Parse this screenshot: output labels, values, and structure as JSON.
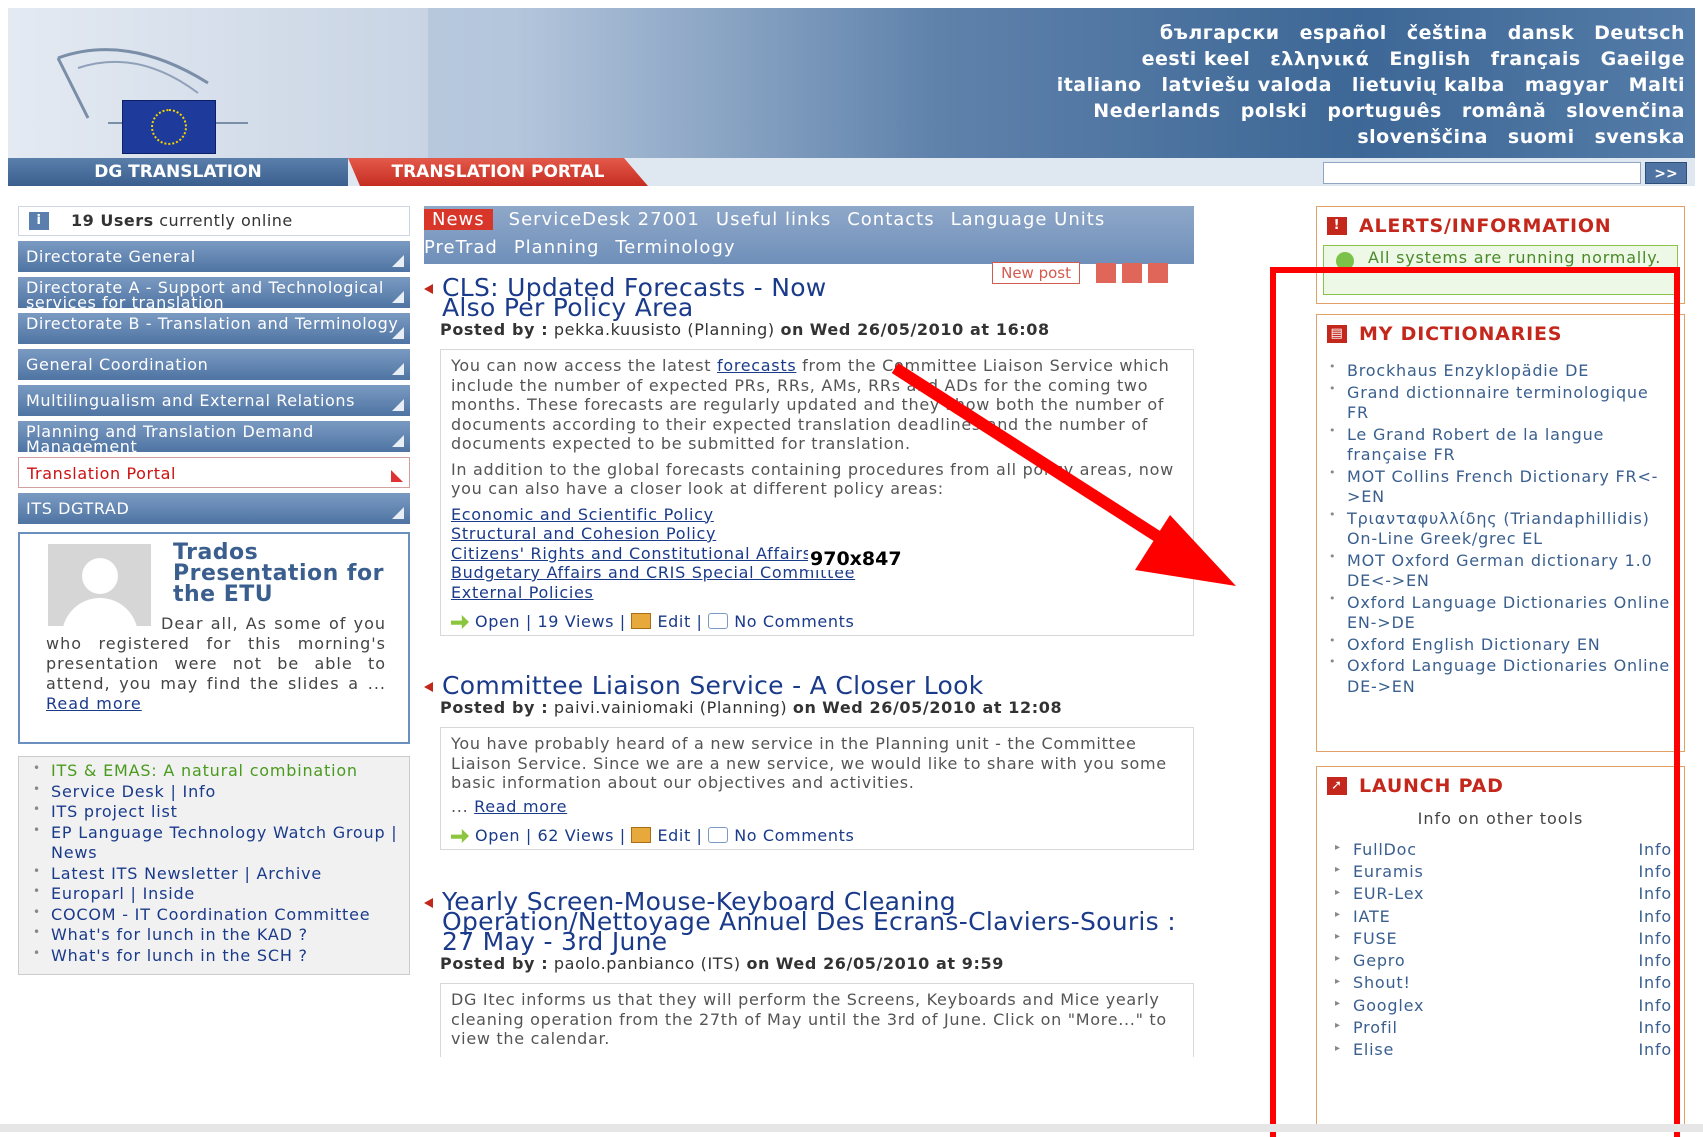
{
  "header": {
    "languages": [
      "български",
      "español",
      "čeština",
      "dansk",
      "Deutsch",
      "eesti keel",
      "ελληνικά",
      "English",
      "français",
      "Gaeilge",
      "italiano",
      "latviešu valoda",
      "lietuvių kalba",
      "magyar",
      "Malti",
      "Nederlands",
      "polski",
      "português",
      "română",
      "slovenčina",
      "slovenščina",
      "suomi",
      "svenska"
    ],
    "tab_dg": "DG TRANSLATION",
    "tab_portal": "TRANSLATION PORTAL",
    "search_button": ">>"
  },
  "left": {
    "users_count": "19 Users",
    "users_suffix": "currently online",
    "menu": [
      {
        "label": "Directorate General"
      },
      {
        "label": "Directorate A - Support and Technological services for translation"
      },
      {
        "label": "Directorate B - Translation and Terminology"
      },
      {
        "label": "General Coordination"
      },
      {
        "label": "Multilingualism and External Relations"
      },
      {
        "label": "Planning and Translation Demand Management"
      },
      {
        "label": "Translation Portal"
      },
      {
        "label": "ITS DGTRAD"
      }
    ],
    "trados": {
      "title": "Trados Presentation for the ETU",
      "text": "Dear all, As some of you who registered for this morning's presentation were not be able to attend, you may find the slides a ...",
      "read_more": "Read more"
    },
    "links": [
      "ITS & EMAS: A natural combination",
      "Service Desk | Info",
      "ITS project list",
      "EP Language Technology Watch Group | News",
      "Latest ITS Newsletter | Archive",
      "Europarl | Inside",
      "COCOM - IT Coordination Committee",
      "What's for lunch in the KAD ?",
      "What's for lunch in the SCH ?"
    ]
  },
  "nav": {
    "row1": [
      "News",
      "ServiceDesk 27001",
      "Useful links",
      "Contacts",
      "Language Units"
    ],
    "row2": [
      "PreTrad",
      "Planning",
      "Terminology"
    ]
  },
  "toolbar": {
    "new_post": "New post"
  },
  "posts": [
    {
      "title": "CLS: Updated Forecasts - Now Also Per Policy Area",
      "posted_label": "Posted by :",
      "author": "pekka.kuusisto (Planning)",
      "on": "on",
      "date": "Wed 26/05/2010 at 16:08",
      "p1_before": "You can now access the latest",
      "p1_link": "forecasts",
      "p1_after": "from the Committee Liaison Service which include the number of expected PRs, RRs, AMs, RRs and ADs for the coming two months. These forecasts are regularly updated and they show both the number of documents according to their expected translation deadlines and the number of documents expected to be submitted for translation.",
      "p2": "In addition to the global forecasts containing procedures from all policy areas, now you can also have a closer look at different policy areas:",
      "policy_links": [
        "Economic and Scientific Policy",
        "Structural and Cohesion Policy",
        "Citizens' Rights and Constitutional Affairs",
        "Budgetary Affairs and CRIS Special Committee",
        "External Policies"
      ],
      "open": "Open",
      "views": "19 Views",
      "edit": "Edit",
      "comments": "No Comments"
    },
    {
      "title": "Committee Liaison Service - A Closer Look",
      "posted_label": "Posted by :",
      "author": "paivi.vainiomaki (Planning)",
      "on": "on",
      "date": "Wed 26/05/2010 at 12:08",
      "text": "You have probably heard of a new service in the Planning unit - the Committee Liaison Service. Since we are a new service, we would like to share with you some basic information about our objectives and activities.",
      "read_more": "Read more",
      "open": "Open",
      "views": "62 Views",
      "edit": "Edit",
      "comments": "No Comments"
    },
    {
      "title": "Yearly Screen-Mouse-Keyboard Cleaning Operation/Nettoyage Annuel Des Écrans-Claviers-Souris : 27 May - 3rd June",
      "posted_label": "Posted by :",
      "author": "paolo.panbianco (ITS)",
      "on": "on",
      "date": "Wed 26/05/2010 at 9:59",
      "text": "DG Itec informs us that they will perform the Screens, Keyboards and Mice yearly cleaning operation from the 27th of May until the 3rd of June. Click on \"More...\" to view the calendar."
    }
  ],
  "right": {
    "alerts_title": "ALERTS/INFORMATION",
    "alerts_msg": "All systems are running normally.",
    "dicts_title": "MY DICTIONARIES",
    "dicts": [
      "Brockhaus Enzyklopädie DE",
      "Grand dictionnaire terminologique FR",
      "Le Grand Robert de la langue française FR",
      "MOT Collins French Dictionary FR<->EN",
      "Τριανταφυλλίδης (Triandaphillidis) On-Line Greek/grec EL",
      "MOT Oxford German dictionary 1.0 DE<->EN",
      "Oxford Language Dictionaries Online EN->DE",
      "Oxford English Dictionary EN",
      "Oxford Language Dictionaries Online DE->EN"
    ],
    "launch_title": "LAUNCH PAD",
    "launch_sub": "Info on other tools",
    "tools": [
      {
        "name": "FullDoc",
        "info": "Info"
      },
      {
        "name": "Euramis",
        "info": "Info"
      },
      {
        "name": "EUR-Lex",
        "info": "Info"
      },
      {
        "name": "IATE",
        "info": "Info"
      },
      {
        "name": "FUSE",
        "info": "Info"
      },
      {
        "name": "Gepro",
        "info": "Info"
      },
      {
        "name": "Shout!",
        "info": "Info"
      },
      {
        "name": "Googlex",
        "info": "Info"
      },
      {
        "name": "Profil",
        "info": "Info"
      },
      {
        "name": "Elise",
        "info": "Info"
      }
    ]
  },
  "annotation": {
    "dims": "970x847"
  }
}
